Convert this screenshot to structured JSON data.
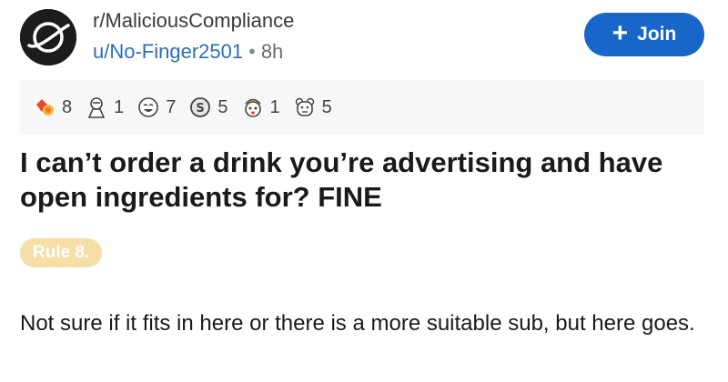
{
  "post": {
    "subreddit": "r/MaliciousCompliance",
    "author": "u/No-Finger2501",
    "separator": "•",
    "age": "8h",
    "join_label": "Join",
    "join_icon": "plus-icon",
    "title": "I can’t order a drink you’re advertising and have open ingredients for? FINE",
    "flair": "Rule 8.",
    "body": "Not sure if it fits in here or there is a more suitable sub, but here goes."
  },
  "awards": [
    {
      "icon": "wholesome-award-icon",
      "count": "8"
    },
    {
      "icon": "helpful-award-icon",
      "count": "1"
    },
    {
      "icon": "laughing-award-icon",
      "count": "7"
    },
    {
      "icon": "silver-award-icon",
      "count": "5"
    },
    {
      "icon": "mindblown-award-icon",
      "count": "1"
    },
    {
      "icon": "bear-award-icon",
      "count": "5"
    }
  ],
  "colors": {
    "accent": "#1866c9",
    "flair_bg": "#f5dfa6",
    "awards_bg": "#f6f7f8",
    "username": "#2c6fb3"
  }
}
